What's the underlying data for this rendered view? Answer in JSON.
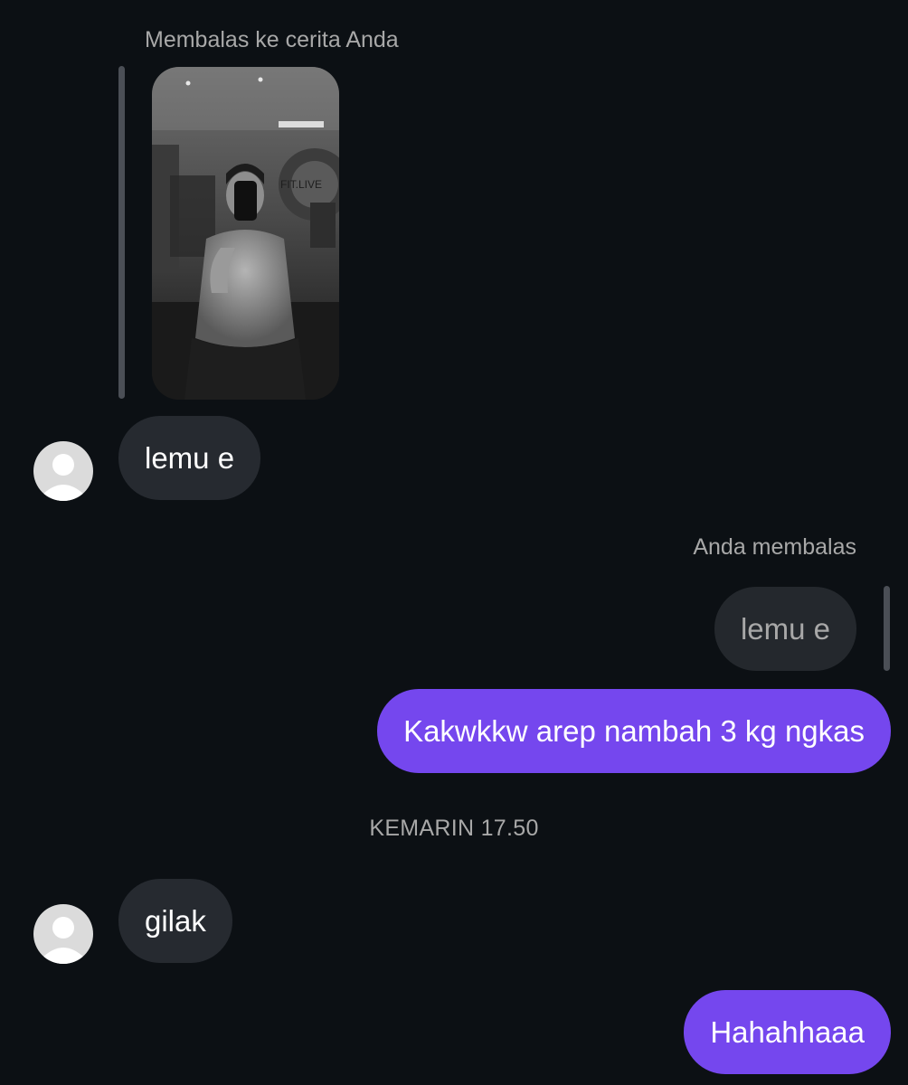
{
  "conversation": {
    "story_reply_caption": "Membalas ke cerita Anda",
    "messages": [
      {
        "sender": "other",
        "text": "lemu e"
      },
      {
        "sender": "me",
        "caption": "Anda membalas",
        "quoted_text": "lemu e",
        "text": "Kakwkkw arep nambah 3 kg ngkas"
      },
      {
        "sender": "other",
        "text": "gilak"
      },
      {
        "sender": "me",
        "text": "Hahahhaaa"
      }
    ],
    "timestamp": "KEMARIN 17.50",
    "story_sign_text": "FIT.LIVE"
  },
  "colors": {
    "background": "#0c1014",
    "incoming_bubble": "#262a30",
    "outgoing_bubble": "#7547ee",
    "secondary_text": "#a8a8a8",
    "avatar_placeholder": "#dbdbdb"
  },
  "icons": [
    "default-avatar-icon"
  ]
}
